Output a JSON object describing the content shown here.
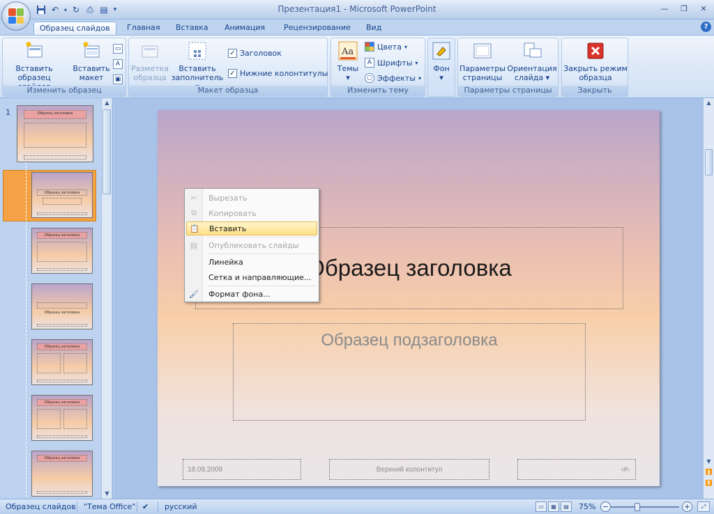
{
  "window": {
    "title": "Презентация1 - Microsoft PowerPoint",
    "min_symbol": "—",
    "max_symbol": "❐",
    "close_symbol": "✕"
  },
  "quick_access": {
    "icons": [
      "save-icon",
      "undo-icon",
      "redo-icon",
      "print-preview-icon",
      "format-painter-icon"
    ],
    "customize_symbol": "▾"
  },
  "tabs": [
    {
      "label": "Образец слайдов",
      "active": true
    },
    {
      "label": "Главная"
    },
    {
      "label": "Вставка"
    },
    {
      "label": "Анимация"
    },
    {
      "label": "Рецензирование"
    },
    {
      "label": "Вид"
    }
  ],
  "help_symbol": "?",
  "ribbon": {
    "edit_master": {
      "label": "Изменить образец",
      "insert_master": "Вставить образец слайдов",
      "insert_layout": "Вставить макет"
    },
    "master_layout": {
      "label": "Макет образца",
      "master_layout_btn": "Разметка образца",
      "insert_placeholder": "Вставить заполнитель",
      "title_check": "Заголовок",
      "footer_check": "Нижние колонтитулы"
    },
    "edit_theme": {
      "label": "Изменить тему",
      "themes": "Темы",
      "colors": "Цвета",
      "fonts": "Шрифты",
      "effects": "Эффекты"
    },
    "background": {
      "label": "Фон"
    },
    "page_setup": {
      "label": "Параметры страницы",
      "page_setup_btn": "Параметры страницы",
      "orientation": "Ориентация слайда"
    },
    "close": {
      "label": "Закрыть",
      "close_btn": "Закрыть режим образца"
    }
  },
  "thumbnails": {
    "master_number": "1",
    "items": [
      {
        "title": "Образец заголовка"
      },
      {
        "title": "Образец заголовка",
        "selected": true
      },
      {
        "title": "Образец заголовка"
      },
      {
        "title": "Образец заголовка"
      },
      {
        "title": "Образец заголовка"
      },
      {
        "title": "Образец заголовка"
      },
      {
        "title": "Образец заголовка"
      }
    ]
  },
  "slide": {
    "title": "Образец заголовка",
    "subtitle": "Образец подзаголовка",
    "date": "18.09.2009",
    "footer": "Верхний колонтитул",
    "slide_number": "‹#›"
  },
  "context_menu": {
    "items": [
      {
        "label": "Вырезать",
        "icon": "scissors-icon",
        "disabled": true
      },
      {
        "label": "Копировать",
        "icon": "copy-icon",
        "disabled": true
      },
      {
        "label": "Вставить",
        "icon": "paste-icon",
        "highlighted": true
      },
      {
        "label": "Опубликовать слайды",
        "icon": "publish-icon",
        "disabled": true
      },
      {
        "label": "Линейка"
      },
      {
        "label": "Сетка и направляющие..."
      },
      {
        "label": "Формат фона...",
        "icon": "format-background-icon"
      }
    ]
  },
  "statusbar": {
    "view": "Образец слайдов",
    "theme": "\"Тема Office\"",
    "language": "русский",
    "zoom": "75%"
  },
  "colors": {
    "ribbon_blue": "#15428b",
    "highlight": "#ffe08a",
    "selected_thumb": "#f4a245"
  }
}
